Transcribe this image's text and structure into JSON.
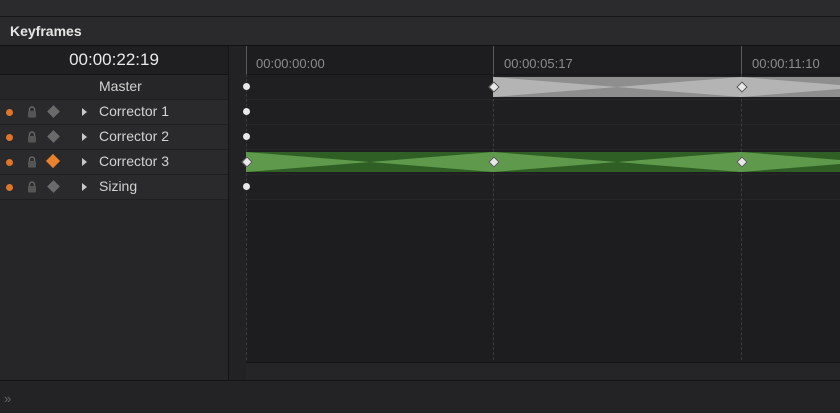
{
  "panel": {
    "title": "Keyframes"
  },
  "timecode": "00:00:22:19",
  "ruler": {
    "labels": [
      "00:00:00:00",
      "00:00:05:17",
      "00:00:11:10"
    ]
  },
  "tracks": [
    {
      "name": "Master"
    },
    {
      "name": "Corrector 1"
    },
    {
      "name": "Corrector 2"
    },
    {
      "name": "Corrector 3"
    },
    {
      "name": "Sizing"
    }
  ],
  "colors": {
    "accent_orange": "#e0742a",
    "master_segment": "#9a9a9a",
    "corrector3_segment": "#3d7a2e"
  },
  "footer": {
    "expand_glyph": "»"
  }
}
